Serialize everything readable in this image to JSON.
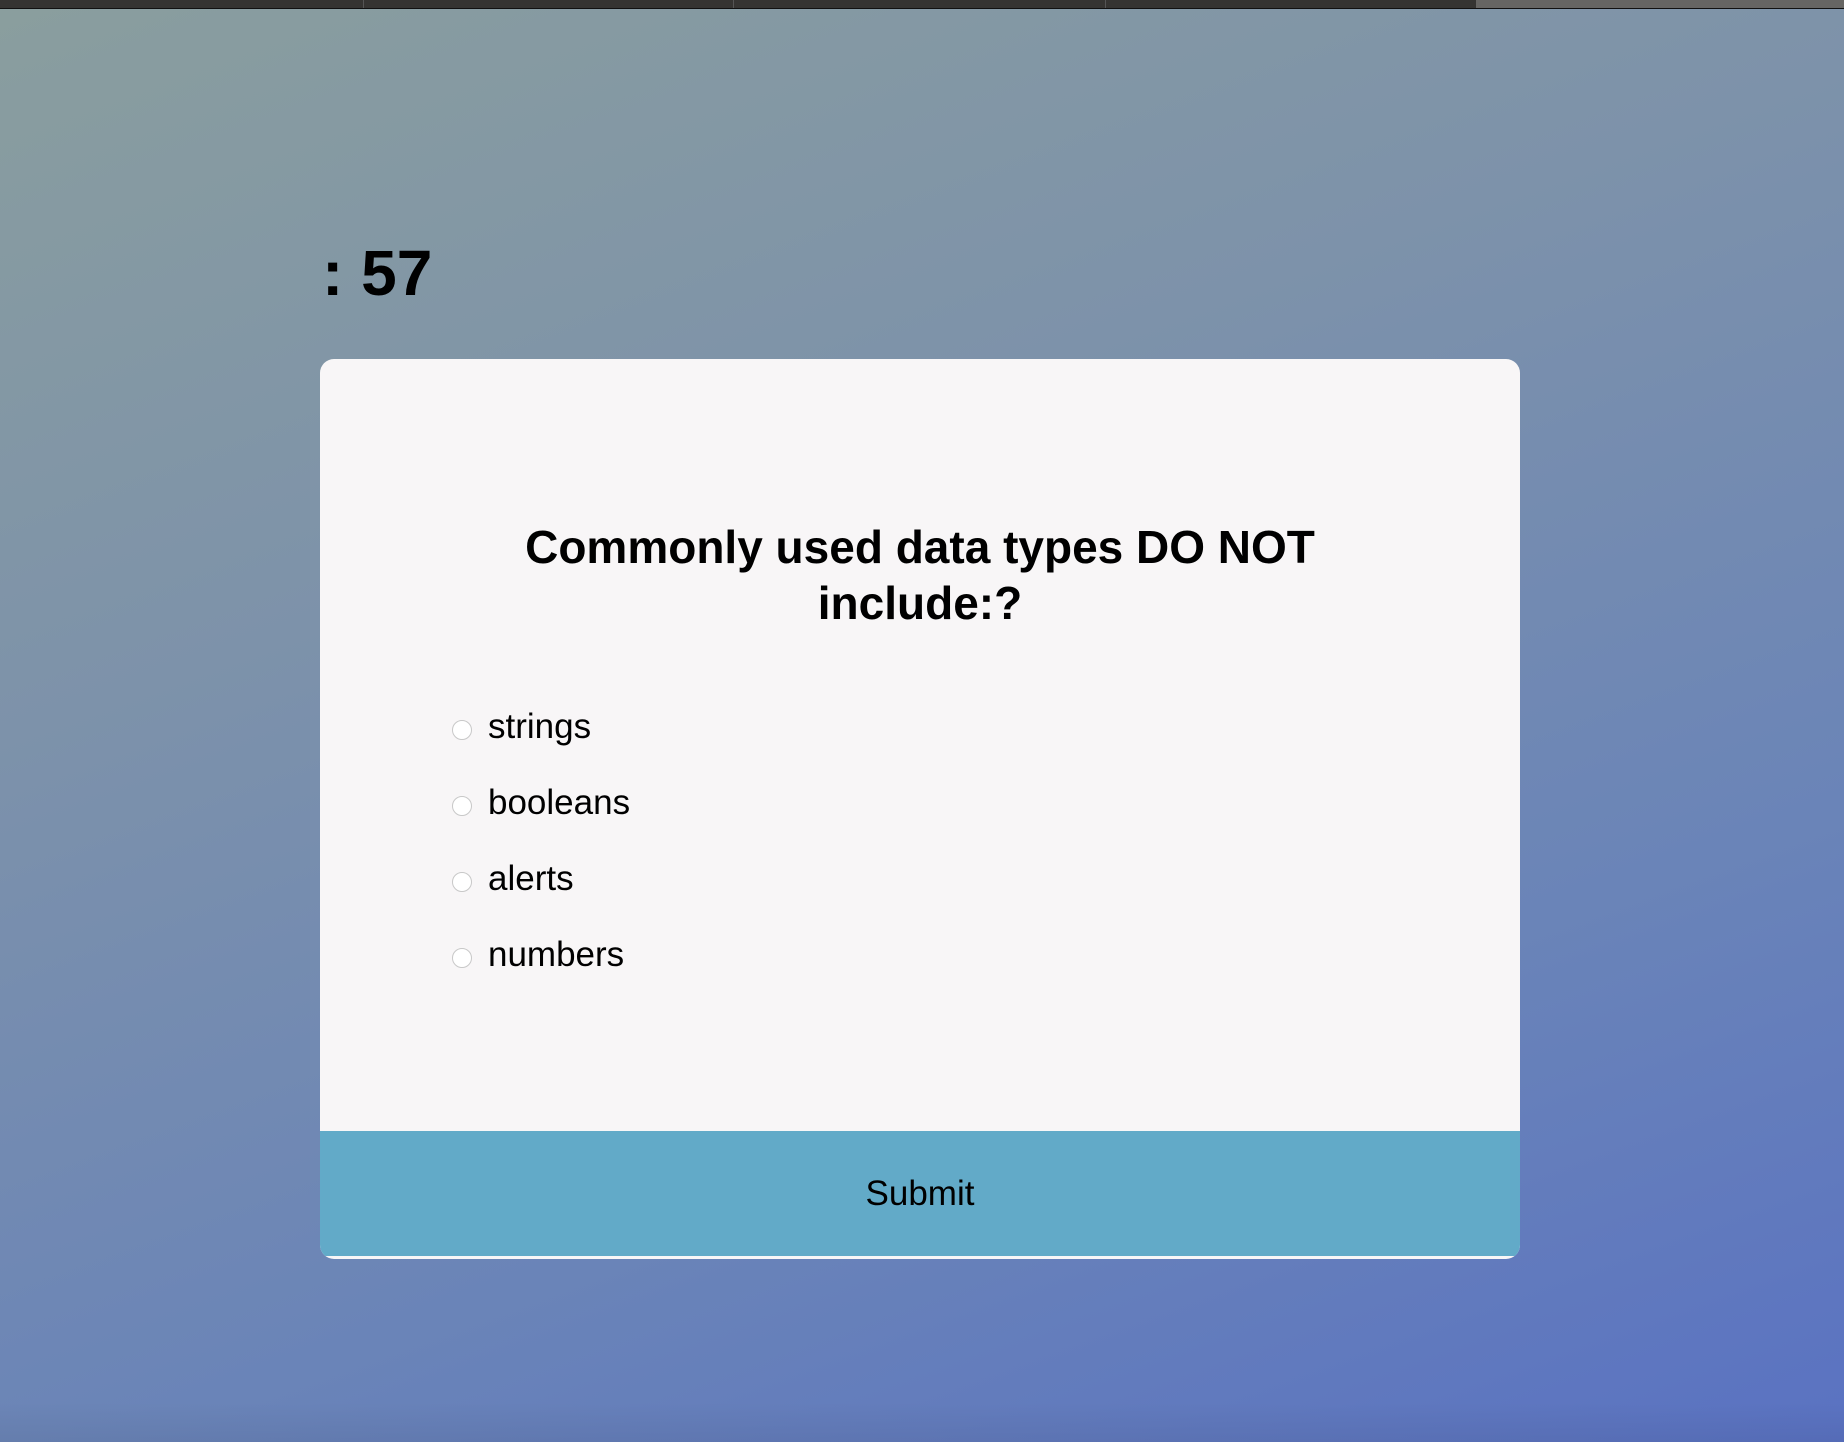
{
  "timer": {
    "text": ": 57"
  },
  "quiz": {
    "question": "Commonly used data types DO NOT include:?",
    "options": [
      {
        "label": "strings",
        "selected": false
      },
      {
        "label": "booleans",
        "selected": false
      },
      {
        "label": "alerts",
        "selected": false
      },
      {
        "label": "numbers",
        "selected": false
      }
    ],
    "submit_label": "Submit"
  },
  "colors": {
    "submit_bg": "#62aac8",
    "card_bg": "#f8f6f7",
    "bg_start": "#8a9e9e",
    "bg_end": "#5a72c2"
  }
}
